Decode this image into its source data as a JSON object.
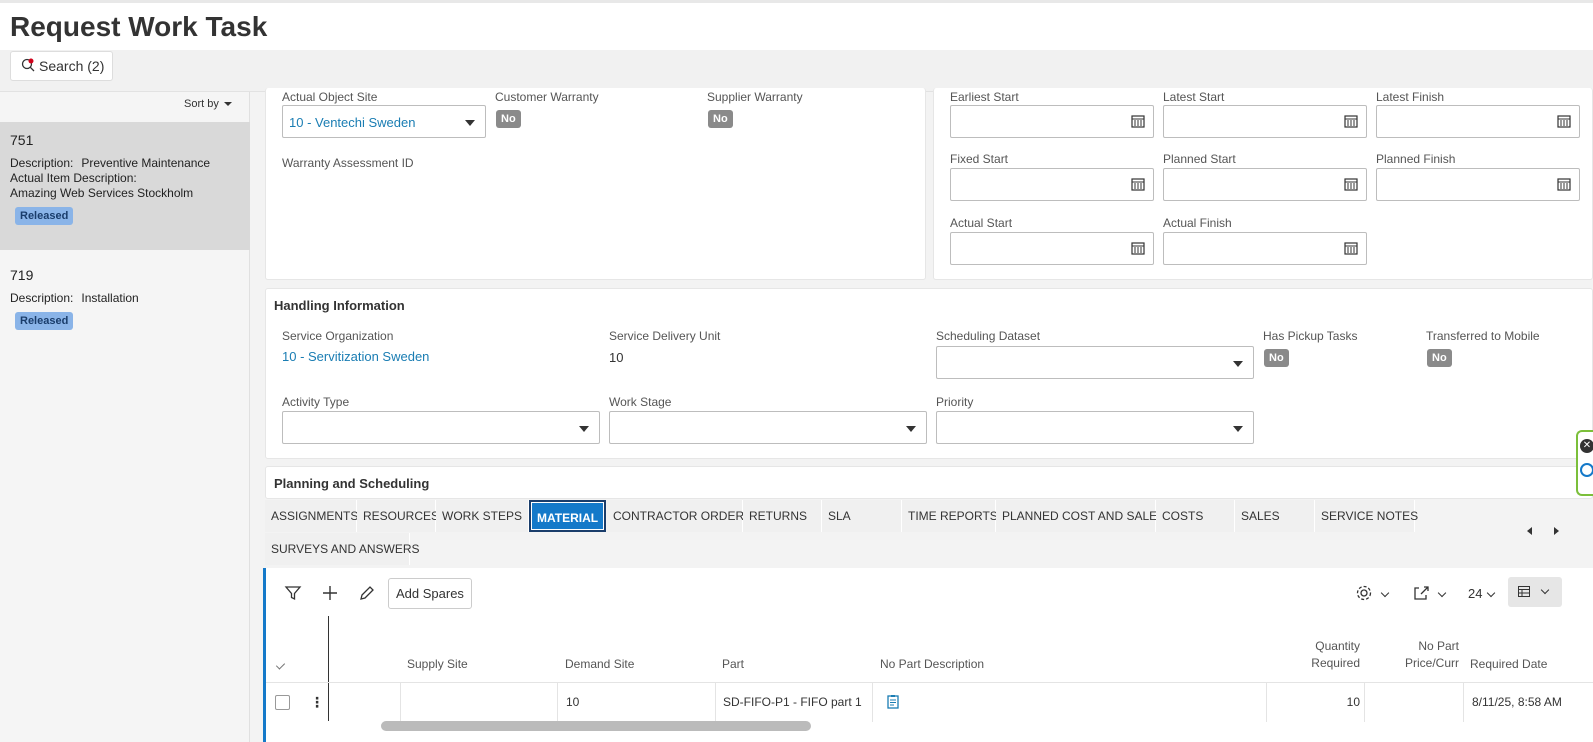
{
  "header": {
    "title": "Request Work Task"
  },
  "search": {
    "label": "Search (2)"
  },
  "list": {
    "sort_label": "Sort by",
    "items": [
      {
        "id": "751",
        "desc_label": "Description:",
        "desc": "Preventive Maintenance",
        "actual_item_label": "Actual Item Description:",
        "actual_item": "Amazing Web Services Stockholm",
        "status": "Released"
      },
      {
        "id": "719",
        "desc_label": "Description:",
        "desc": "Installation",
        "status": "Released"
      }
    ]
  },
  "object": {
    "actual_object_site_label": "Actual Object Site",
    "actual_object_site": "10 - Ventechi Sweden",
    "customer_warranty_label": "Customer Warranty",
    "customer_warranty": "No",
    "supplier_warranty_label": "Supplier Warranty",
    "supplier_warranty": "No",
    "warranty_assessment_label": "Warranty Assessment ID"
  },
  "dates": {
    "earliest_start": "Earliest Start",
    "latest_start": "Latest Start",
    "latest_finish": "Latest Finish",
    "fixed_start": "Fixed Start",
    "planned_start": "Planned Start",
    "planned_finish": "Planned Finish",
    "actual_start": "Actual Start",
    "actual_finish": "Actual Finish"
  },
  "handling": {
    "title": "Handling Information",
    "service_org_label": "Service Organization",
    "service_org": "10 - Servitization Sweden",
    "sdu_label": "Service Delivery Unit",
    "sdu": "10",
    "sched_dataset_label": "Scheduling Dataset",
    "has_pickup_label": "Has Pickup Tasks",
    "has_pickup": "No",
    "transferred_label": "Transferred to Mobile",
    "transferred": "No",
    "activity_type_label": "Activity Type",
    "work_stage_label": "Work Stage",
    "priority_label": "Priority"
  },
  "planning": {
    "title": "Planning and Scheduling"
  },
  "tabs": [
    "ASSIGNMENTS",
    "RESOURCES",
    "WORK STEPS",
    "MATERIAL",
    "CONTRACTOR ORDERS",
    "RETURNS",
    "SLA",
    "TIME REPORTS",
    "PLANNED COST AND SALES",
    "COSTS",
    "SALES",
    "SERVICE NOTES",
    "SURVEYS AND ANSWERS"
  ],
  "table": {
    "add_spares": "Add Spares",
    "page_size": "24",
    "columns": {
      "supply_site": "Supply Site",
      "demand_site": "Demand Site",
      "part": "Part",
      "no_part_desc": "No Part Description",
      "qty_1": "Quantity",
      "qty_2": "Required",
      "price_1": "No Part",
      "price_2": "Price/Curr",
      "required_date": "Required Date"
    },
    "rows": [
      {
        "supply_site": "",
        "demand_site": "10",
        "part": "SD-FIFO-P1 - FIFO part 1",
        "qty": "10",
        "price": "",
        "required_date": "8/11/25, 8:58 AM"
      }
    ]
  }
}
